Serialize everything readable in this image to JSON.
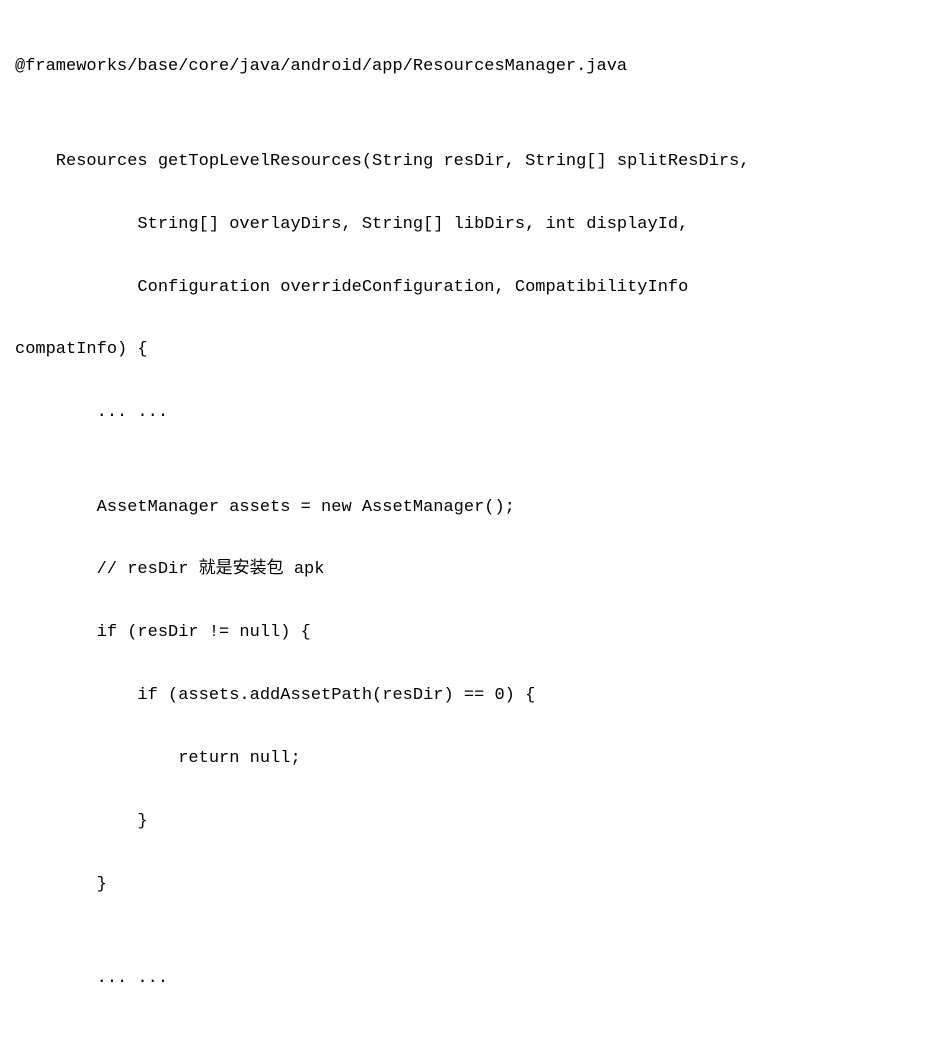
{
  "code": {
    "line1": "@frameworks/base/core/java/android/app/ResourcesManager.java",
    "line2": "",
    "line3": "    Resources getTopLevelResources(String resDir, String[] splitResDirs,",
    "line4": "            String[] overlayDirs, String[] libDirs, int displayId,",
    "line5": "            Configuration overrideConfiguration, CompatibilityInfo",
    "line6": "compatInfo) {",
    "line7": "        ... ...",
    "line8": "",
    "line9": "        AssetManager assets = new AssetManager();",
    "line10": "        // resDir 就是安装包 apk",
    "line11": "        if (resDir != null) {",
    "line12": "            if (assets.addAssetPath(resDir) == 0) {",
    "line13": "                return null;",
    "line14": "            }",
    "line15": "        }",
    "line16": "",
    "line17": "        ... ..."
  }
}
